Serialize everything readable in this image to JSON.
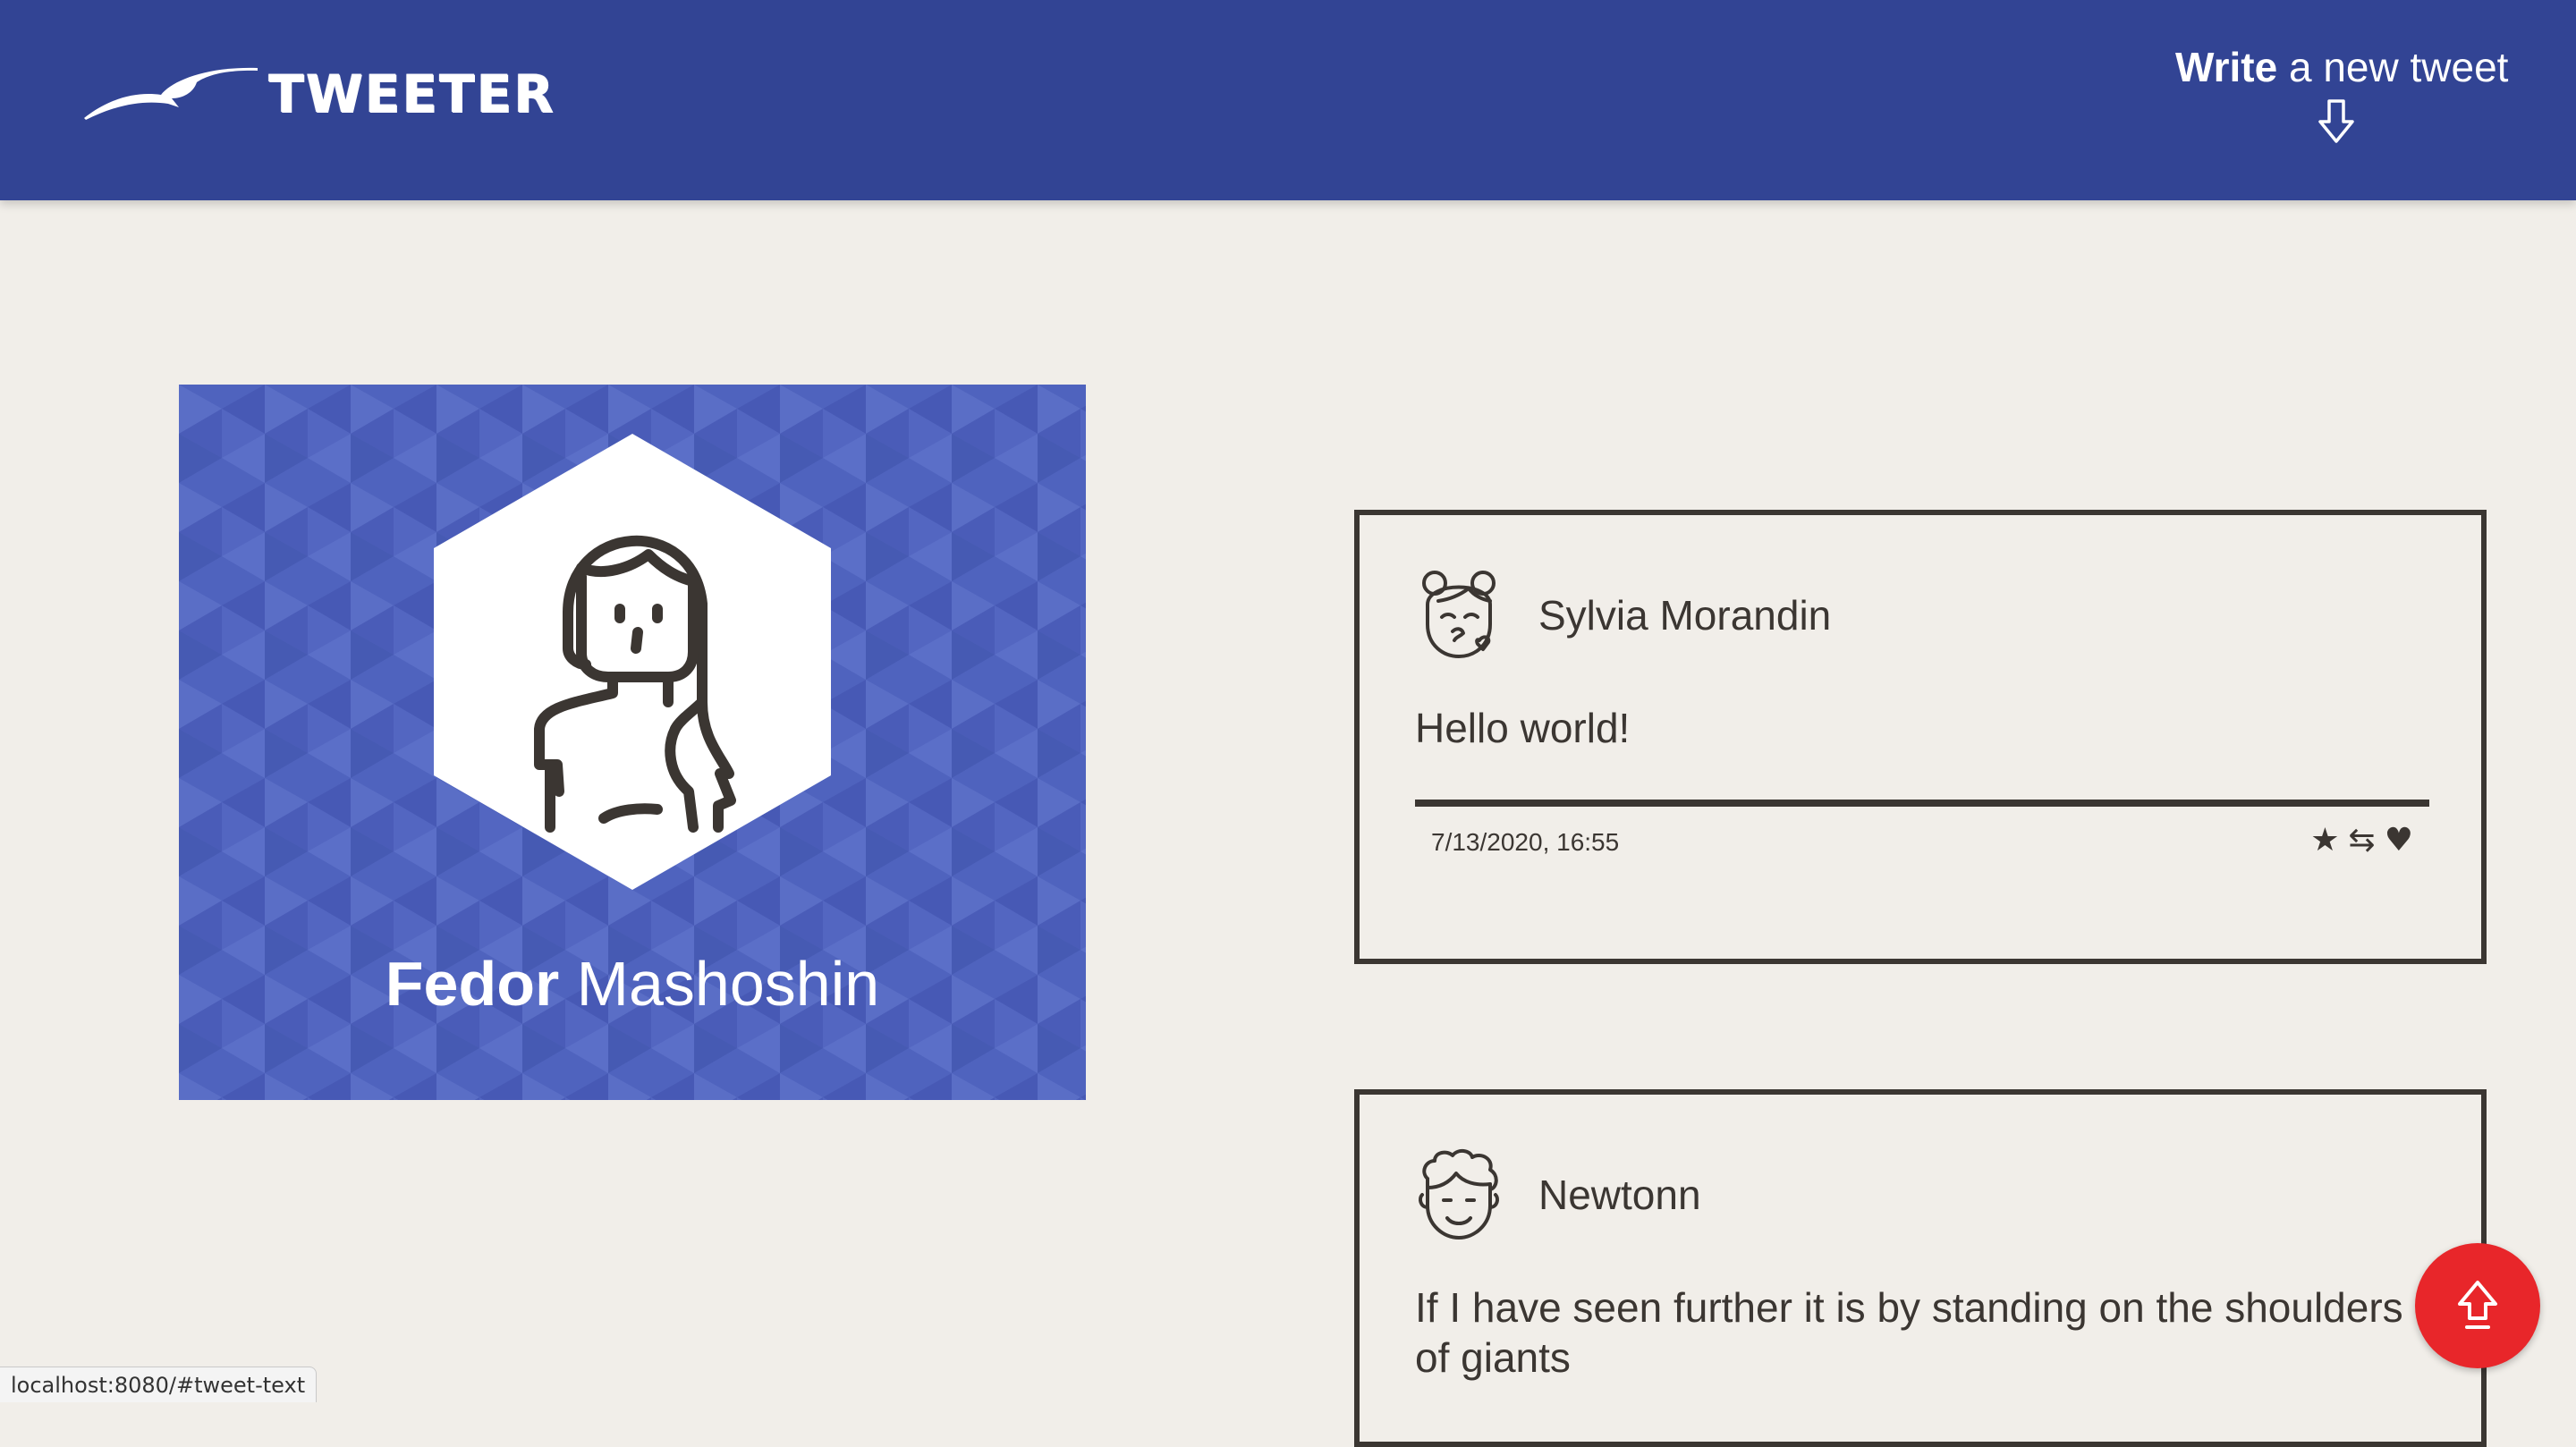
{
  "nav": {
    "brand": "TWEETER",
    "compose_strong": "Write",
    "compose_rest": " a new tweet"
  },
  "profile": {
    "first_name": "Fedor",
    "last_name": " Mashoshin"
  },
  "tweets": [
    {
      "author": "Sylvia Morandin",
      "text": "Hello world!",
      "date": "7/13/2020, 16:55",
      "actions": {
        "like": "★",
        "retweet": "⇆",
        "favorite": "♥"
      }
    },
    {
      "author": "Newtonn",
      "text": "If I have seen further it is by standing on the shoulders of giants"
    }
  ],
  "status_bar": {
    "url": "localhost:8080/#tweet-text"
  },
  "colors": {
    "nav_bg": "#324494",
    "page_bg": "#f1eee9",
    "profile_bg": "#4f63be",
    "ink": "#3b3632",
    "to_top_bg": "#e8262a"
  }
}
